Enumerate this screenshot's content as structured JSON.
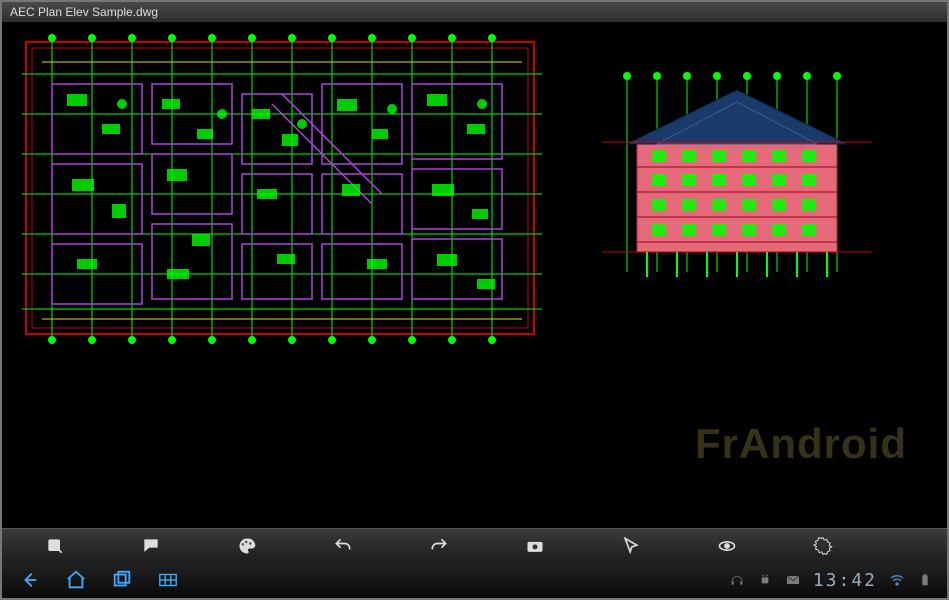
{
  "window": {
    "title": "AEC Plan Elev Sample.dwg"
  },
  "watermark": "FrAndroid",
  "toolbar": {
    "items": [
      {
        "name": "draw-tool-icon"
      },
      {
        "name": "annotate-tool-icon"
      },
      {
        "name": "palette-tool-icon"
      },
      {
        "name": "undo-icon"
      },
      {
        "name": "redo-icon"
      },
      {
        "name": "camera-icon"
      },
      {
        "name": "select-tool-icon"
      },
      {
        "name": "visibility-icon"
      },
      {
        "name": "settings-icon"
      }
    ]
  },
  "navbar": {
    "items": [
      {
        "name": "back-nav-icon"
      },
      {
        "name": "home-nav-icon"
      },
      {
        "name": "recent-apps-nav-icon"
      },
      {
        "name": "apps-grid-nav-icon"
      }
    ]
  },
  "status": {
    "clock": "13:42",
    "icons": [
      {
        "name": "headphones-icon"
      },
      {
        "name": "android-icon"
      },
      {
        "name": "mail-icon"
      }
    ],
    "right_icons": [
      {
        "name": "wifi-icon"
      },
      {
        "name": "battery-icon"
      }
    ]
  },
  "drawing": {
    "plan_view": {
      "border_color": "#cc0000",
      "grid_color": "#00ff00",
      "wall_color": "#a040ff"
    },
    "elevation_view": {
      "wall_fill": "#e46a7a",
      "line_color": "#00ff00",
      "roof_color": "#1a3a6a"
    }
  }
}
